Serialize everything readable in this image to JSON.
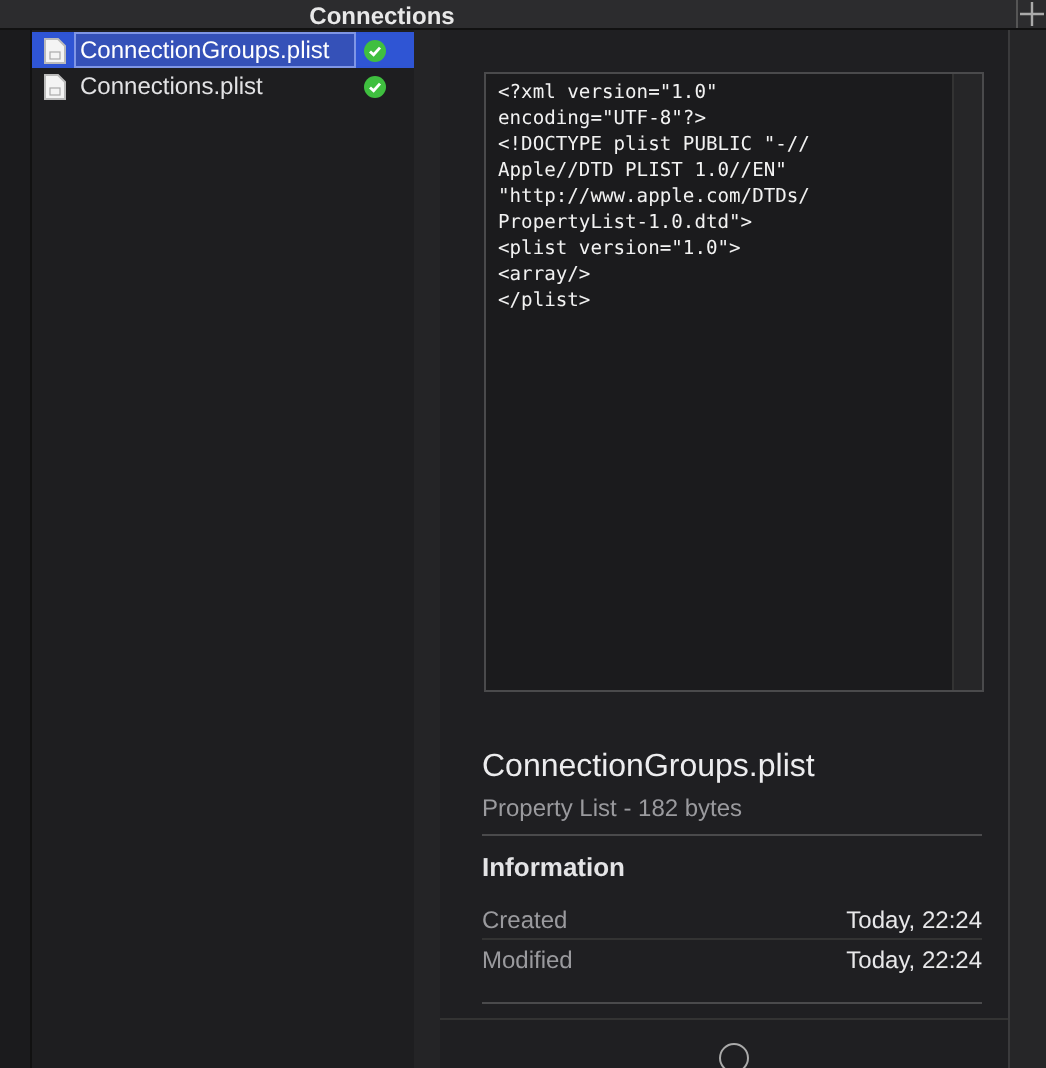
{
  "window": {
    "title": "Connections"
  },
  "files": [
    {
      "name": "ConnectionGroups.plist",
      "selected": true,
      "synced": true
    },
    {
      "name": "Connections.plist",
      "selected": false,
      "synced": true
    }
  ],
  "preview": {
    "lines": [
      "<?xml version=\"1.0\"",
      "encoding=\"UTF-8\"?>",
      "<!DOCTYPE plist PUBLIC \"-//",
      "Apple//DTD PLIST 1.0//EN\"",
      "\"http://www.apple.com/DTDs/",
      "PropertyList-1.0.dtd\">",
      "<plist version=\"1.0\">",
      "<array/>",
      "</plist>"
    ]
  },
  "details": {
    "name": "ConnectionGroups.plist",
    "kind": "Property List - 182 bytes",
    "section": "Information",
    "rows": [
      {
        "label": "Created",
        "value": "Today, 22:24"
      },
      {
        "label": "Modified",
        "value": "Today, 22:24"
      }
    ]
  }
}
